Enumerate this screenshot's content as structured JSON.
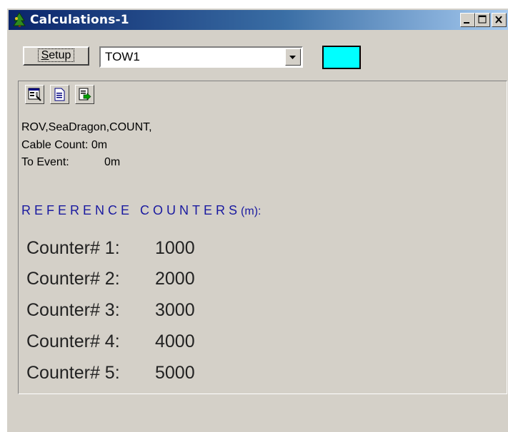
{
  "window": {
    "title": "Calculations-1",
    "controls": {
      "minimize": "_",
      "maximize": "□",
      "close": "X"
    }
  },
  "toolbar": {
    "setup_label": "Setup",
    "setup_mnemonic": "S",
    "tow_select": {
      "selected": "TOW1"
    },
    "color_swatch": "#00ffff"
  },
  "tools": [
    {
      "icon": "properties-icon"
    },
    {
      "icon": "document-icon"
    },
    {
      "icon": "export-icon"
    }
  ],
  "info": {
    "message": "ROV,SeaDragon,COUNT,",
    "cable_count_label": "Cable Count:",
    "cable_count_value": "0m",
    "to_event_label": "To Event:",
    "to_event_value": "0m"
  },
  "reference": {
    "title": "REFERENCE COUNTERS",
    "unit": "(m):",
    "counters": [
      {
        "label": "Counter# 1:",
        "value": "1000"
      },
      {
        "label": "Counter# 2:",
        "value": "2000"
      },
      {
        "label": "Counter# 3:",
        "value": "3000"
      },
      {
        "label": "Counter# 4:",
        "value": "4000"
      },
      {
        "label": "Counter# 5:",
        "value": "5000"
      }
    ]
  },
  "colors": {
    "titlebar": "#0a246a",
    "face": "#d4d0c8",
    "heading": "#1a1aa0"
  }
}
